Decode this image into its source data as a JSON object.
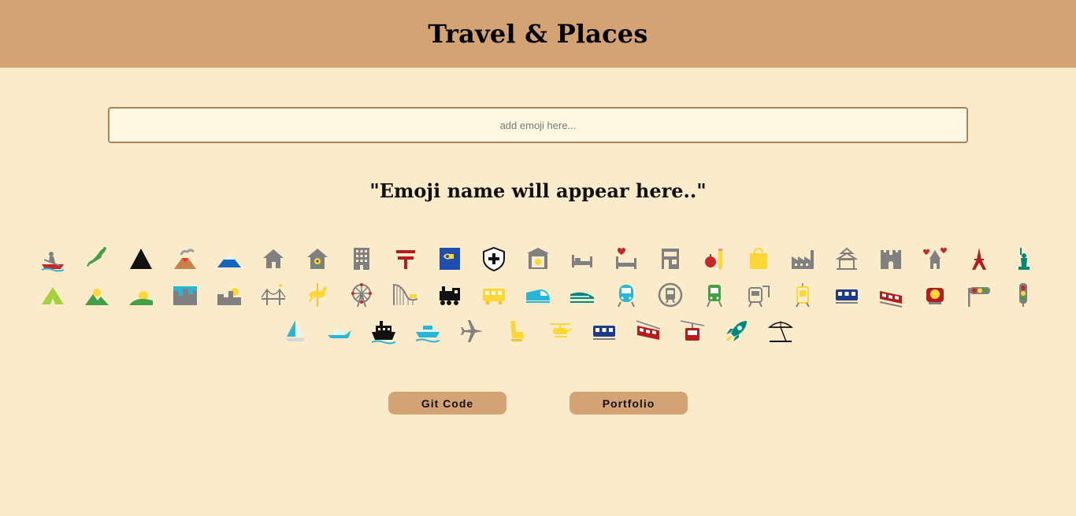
{
  "header": {
    "title": "Travel & Places"
  },
  "search": {
    "placeholder": "add emoji here..."
  },
  "result": {
    "text": "\"Emoji name will appear here..\""
  },
  "emojis": [
    "rowboat-icon",
    "japan-map-icon",
    "mountain-icon",
    "volcano-icon",
    "mount-fuji-icon",
    "house-icon",
    "house-garden-icon",
    "office-building-icon",
    "post-office-icon",
    "post-office-eu-icon",
    "hospital-icon",
    "bank-icon",
    "hotel-icon",
    "love-hotel-icon",
    "convenience-store-icon",
    "school-icon",
    "department-store-icon",
    "factory-icon",
    "japanese-castle-icon",
    "castle-icon",
    "wedding-icon",
    "tokyo-tower-icon",
    "statue-of-liberty-icon",
    "tent-icon",
    "sunrise-mountains-icon",
    "sunrise-icon",
    "cityscape-dusk-icon",
    "sunset-city-icon",
    "night-bridge-icon",
    "carousel-horse-icon",
    "ferris-wheel-icon",
    "roller-coaster-icon",
    "locomotive-icon",
    "railway-car-icon",
    "high-speed-train-icon",
    "bullet-train-icon",
    "train-icon",
    "metro-icon",
    "light-rail-icon",
    "station-icon",
    "tram-icon",
    "tram-car-icon",
    "bus-icon",
    "trolleybus-icon",
    "police-light-icon",
    "horizontal-traffic-light-icon",
    "vertical-traffic-light-icon",
    "sailboat-icon",
    "speedboat-icon",
    "ship-icon",
    "ferry-icon",
    "airplane-icon",
    "seat-icon",
    "helicopter-icon",
    "suburban-railway-icon",
    "mountain-cableway-icon",
    "aerial-tramway-icon",
    "rocket-icon",
    "beach-umbrella-icon"
  ],
  "buttons": {
    "git": "Git Code",
    "portfolio": "Portfolio"
  },
  "colors": {
    "header_bg": "#d4a373",
    "page_bg": "#faebcb",
    "input_bg": "#fff8e0",
    "button_bg": "#d4a373",
    "icon_gray": "#808080",
    "icon_red": "#b71c1c",
    "icon_yellow": "#fdd835",
    "icon_cyan": "#29b6d6",
    "icon_green": "#43a047",
    "icon_blue": "#1e3a8a"
  }
}
